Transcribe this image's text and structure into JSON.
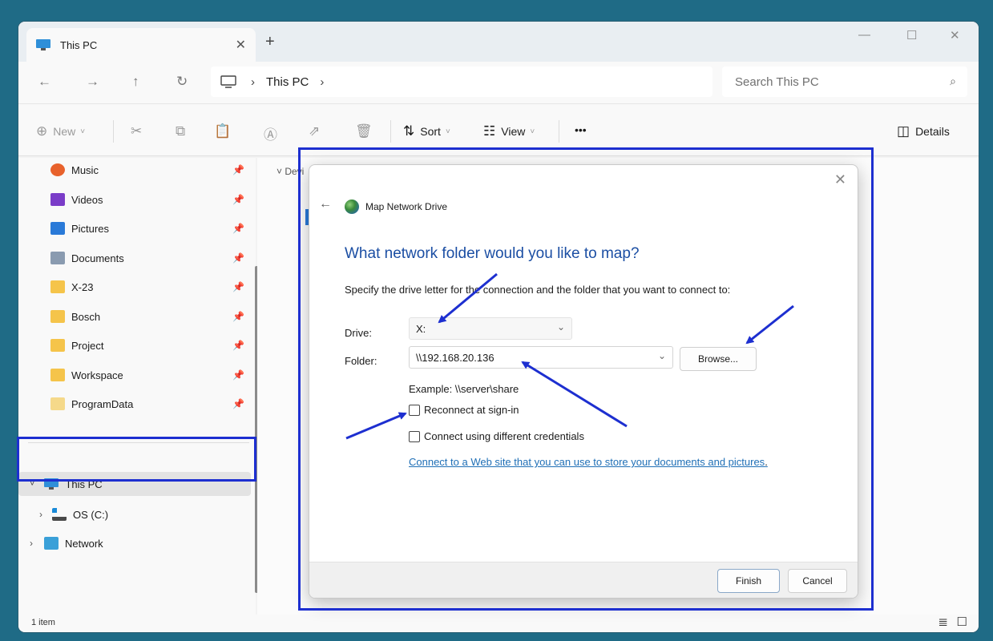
{
  "window": {
    "tab_title": "This PC",
    "controls": {
      "minimize": "—",
      "maximize": "☐",
      "close": "✕"
    }
  },
  "nav": {
    "back": "←",
    "forward": "→",
    "up": "↑",
    "refresh": "↻",
    "breadcrumb": [
      "This PC"
    ],
    "search_placeholder": "Search This PC"
  },
  "toolbar": {
    "new": "New",
    "sort": "Sort",
    "view": "View",
    "more": "•••",
    "details": "Details"
  },
  "sidebar": {
    "quick": [
      {
        "label": "Music",
        "icon": "music-icon",
        "color": "#e8622c"
      },
      {
        "label": "Videos",
        "icon": "videos-icon",
        "color": "#7a3cc8"
      },
      {
        "label": "Pictures",
        "icon": "pictures-icon",
        "color": "#2a7ad8"
      },
      {
        "label": "Documents",
        "icon": "documents-icon",
        "color": "#8a9bb0"
      },
      {
        "label": "X-23",
        "icon": "folder-icon",
        "color": "#f5c44a"
      },
      {
        "label": "Bosch",
        "icon": "folder-icon",
        "color": "#f5c44a"
      },
      {
        "label": "Project",
        "icon": "folder-icon",
        "color": "#f5c44a"
      },
      {
        "label": "Workspace",
        "icon": "folder-icon",
        "color": "#f5c44a"
      },
      {
        "label": "ProgramData",
        "icon": "folder-icon",
        "color": "#f5d98a"
      }
    ],
    "this_pc": "This PC",
    "os_drive": "OS (C:)",
    "network": "Network"
  },
  "content": {
    "group_label": "Devi"
  },
  "status": {
    "items": "1 item"
  },
  "dialog": {
    "title": "Map Network Drive",
    "heading": "What network folder would you like to map?",
    "instructions": "Specify the drive letter for the connection and the folder that you want to connect to:",
    "drive_label": "Drive:",
    "drive_value": "X:",
    "folder_label": "Folder:",
    "folder_value": "\\\\192.168.20.136",
    "browse": "Browse...",
    "example": "Example: \\\\server\\share",
    "reconnect": "Reconnect at sign-in",
    "credentials": "Connect using different credentials",
    "link": "Connect to a Web site that you can use to store your documents and pictures",
    "link_end": ".",
    "finish": "Finish",
    "cancel": "Cancel"
  },
  "colors": {
    "annotation": "#1d2fd0",
    "desktop": "#1f6b86",
    "link": "#1f6fb6",
    "heading": "#1b4ea3"
  }
}
